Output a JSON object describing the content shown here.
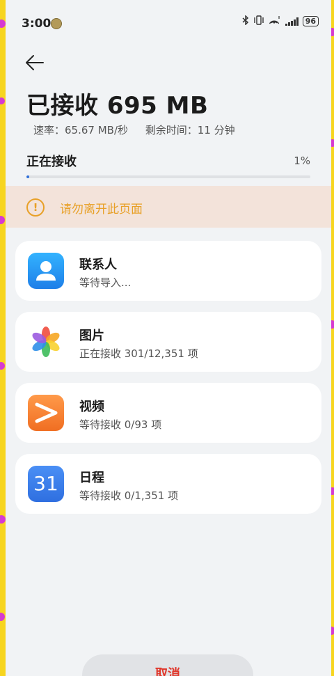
{
  "status_bar": {
    "time": "3:00",
    "battery": "96",
    "icons": [
      "bluetooth-icon",
      "vibrate-icon",
      "hotspot-icon",
      "signal-icon",
      "battery-icon"
    ]
  },
  "header": {
    "title": "已接收 695 MB",
    "speed": "速率：65.67 MB/秒",
    "remaining": "剩余时间：11 分钟"
  },
  "progress": {
    "label": "正在接收",
    "percent_text": "1%",
    "value": 0.01
  },
  "warning": {
    "text": "请勿离开此页面",
    "color": "#e8a027"
  },
  "items": [
    {
      "name": "联系人",
      "status": "等待导入...",
      "icon": "contacts-icon"
    },
    {
      "name": "图片",
      "status": "正在接收 301/12,351 项",
      "icon": "gallery-icon"
    },
    {
      "name": "视频",
      "status": "等待接收 0/93 项",
      "icon": "video-icon"
    },
    {
      "name": "日程",
      "status": "等待接收 0/1,351 项",
      "icon": "calendar-icon",
      "icon_text": "31"
    }
  ],
  "cancel_label": "取消",
  "colors": {
    "accent": "#2f6fd8",
    "cancel_text": "#e0362a",
    "frame_border": "#f7d51f"
  }
}
